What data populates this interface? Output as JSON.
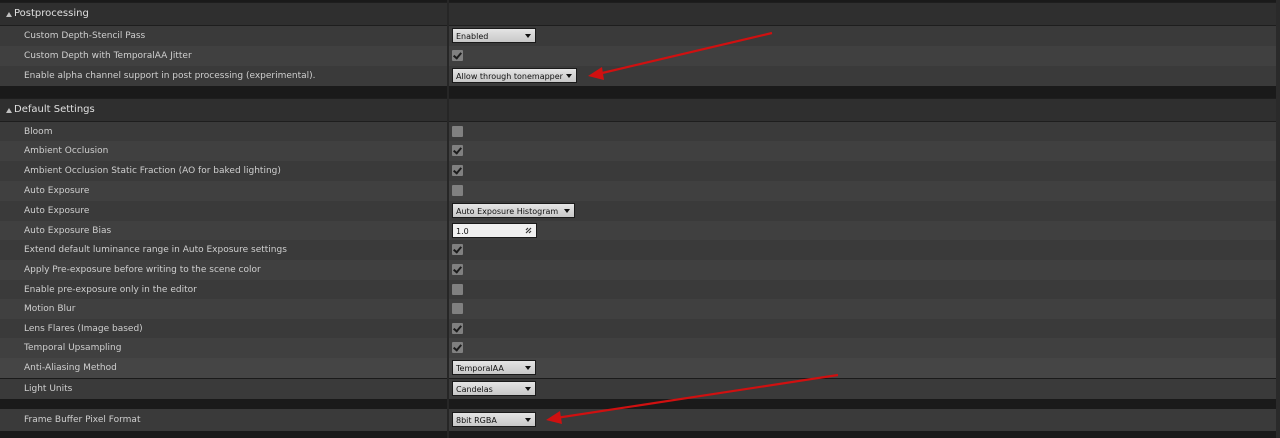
{
  "postprocessing": {
    "title": "Postprocessing",
    "rows": [
      {
        "label": "Custom Depth-Stencil Pass",
        "type": "combo",
        "value": "Enabled"
      },
      {
        "label": "Custom Depth with TemporalAA Jitter",
        "type": "checkbox",
        "checked": true
      },
      {
        "label": "Enable alpha channel support in post processing (experimental).",
        "type": "combo",
        "value": "Allow through tonemapper"
      }
    ]
  },
  "default_settings": {
    "title": "Default Settings",
    "rows": [
      {
        "label": "Bloom",
        "type": "checkbox",
        "checked": false
      },
      {
        "label": "Ambient Occlusion",
        "type": "checkbox",
        "checked": true
      },
      {
        "label": "Ambient Occlusion Static Fraction (AO for baked lighting)",
        "type": "checkbox",
        "checked": true
      },
      {
        "label": "Auto Exposure",
        "type": "checkbox",
        "checked": false
      },
      {
        "label": "Auto Exposure",
        "type": "combo",
        "value": "Auto Exposure Histogram"
      },
      {
        "label": "Auto Exposure Bias",
        "type": "number",
        "value": "1.0"
      },
      {
        "label": "Extend default luminance range in Auto Exposure settings",
        "type": "checkbox",
        "checked": true
      },
      {
        "label": "Apply Pre-exposure before writing to the scene color",
        "type": "checkbox",
        "checked": true
      },
      {
        "label": "Enable pre-exposure only in the editor",
        "type": "checkbox",
        "checked": false
      },
      {
        "label": "Motion Blur",
        "type": "checkbox",
        "checked": false
      },
      {
        "label": "Lens Flares (Image based)",
        "type": "checkbox",
        "checked": true
      },
      {
        "label": "Temporal Upsampling",
        "type": "checkbox",
        "checked": true
      },
      {
        "label": "Anti-Aliasing Method",
        "type": "combo",
        "value": "TemporalAA"
      },
      {
        "label": "Light Units",
        "type": "combo",
        "value": "Candelas"
      },
      {
        "label": "Frame Buffer Pixel Format",
        "type": "combo",
        "value": "8bit RGBA"
      }
    ]
  },
  "colors": {
    "annotation_arrow": "#d01010",
    "panel_bg": "#3a3a3a",
    "header_bg": "#2f2f2f"
  }
}
